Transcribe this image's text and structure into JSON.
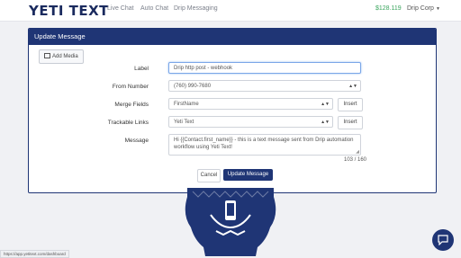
{
  "nav": {
    "logo": "YETI TEXT",
    "links": [
      "Live Chat",
      "Auto Chat",
      "Drip Messaging"
    ],
    "balance": "$128.119",
    "company": "Drip Corp"
  },
  "panel": {
    "title": "Update Message",
    "add_media": "Add Media",
    "label_label": "Label",
    "label_value": "Drip http post - webhook",
    "from_label": "From Number",
    "from_value": "(760) 990-7680",
    "merge_label": "Merge Fields",
    "merge_value": "FirstName",
    "trackable_label": "Trackable Links",
    "trackable_value": "Yeti Text",
    "insert_label": "Insert",
    "message_label": "Message",
    "message_value": "Hi {{Contact.first_name}} - this is a text message sent from Drip automation workflow using Yeti Text!",
    "counter": "103 / 160",
    "cancel": "Cancel",
    "update": "Update Message"
  },
  "status_url": "https://app.yetitext.com/dashboard",
  "colors": {
    "brand": "#1f3575",
    "balance": "#3aa55d"
  }
}
